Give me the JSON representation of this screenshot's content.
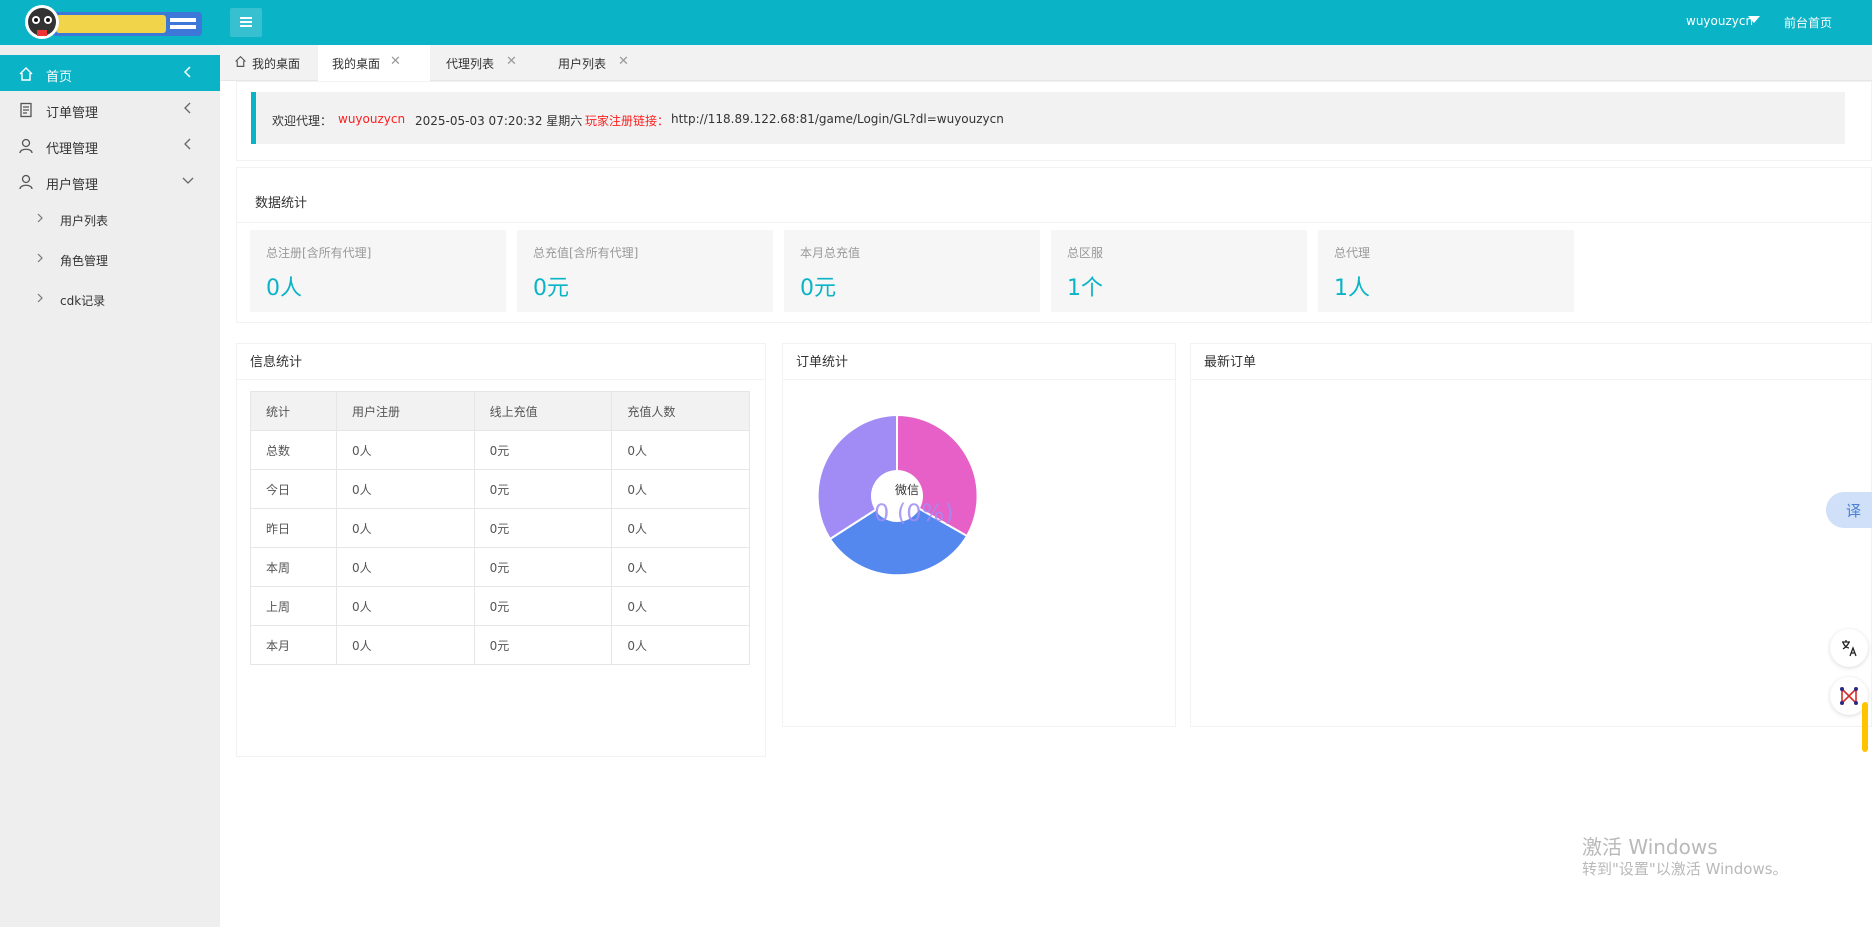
{
  "header": {
    "logo_alt": "游戏后台",
    "username": "wuyouzycn",
    "front_link": "前台首页"
  },
  "sidebar": {
    "items": [
      {
        "label": "首页"
      },
      {
        "label": "订单管理"
      },
      {
        "label": "代理管理"
      },
      {
        "label": "用户管理"
      }
    ],
    "sub_items": [
      {
        "label": "用户列表"
      },
      {
        "label": "角色管理"
      },
      {
        "label": "cdk记录"
      }
    ]
  },
  "tabs": [
    {
      "label": "我的桌面"
    },
    {
      "label": "我的桌面"
    },
    {
      "label": "代理列表"
    },
    {
      "label": "用户列表"
    }
  ],
  "welcome": {
    "prefix": "欢迎代理：",
    "agent": "wuyouzycn",
    "datetime": "2025-05-03  07:20:32  星期六",
    "link_label": "玩家注册链接：",
    "link": "http://118.89.122.68:81/game/Login/GL?dl=wuyouzycn"
  },
  "data_stats": {
    "title": "数据统计",
    "cards": [
      {
        "title": "总注册[含所有代理]",
        "value": "0人"
      },
      {
        "title": "总充值[含所有代理]",
        "value": "0元"
      },
      {
        "title": "本月总充值",
        "value": "0元"
      },
      {
        "title": "总区服",
        "value": "1个"
      },
      {
        "title": "总代理",
        "value": "1人"
      }
    ]
  },
  "info_stats": {
    "title": "信息统计",
    "headers": [
      "统计",
      "用户注册",
      "线上充值",
      "充值人数"
    ],
    "rows": [
      [
        "总数",
        "0人",
        "0元",
        "0人"
      ],
      [
        "今日",
        "0人",
        "0元",
        "0人"
      ],
      [
        "昨日",
        "0人",
        "0元",
        "0人"
      ],
      [
        "本周",
        "0人",
        "0元",
        "0人"
      ],
      [
        "上周",
        "0人",
        "0元",
        "0人"
      ],
      [
        "本月",
        "0人",
        "0元",
        "0人"
      ]
    ]
  },
  "order_stats": {
    "title": "订单统计",
    "center_label": "微信",
    "center_value": "0 (0%)",
    "colors": [
      "#e660c8",
      "#5588ee",
      "#a08cf4"
    ]
  },
  "latest_orders": {
    "title": "最新订单"
  },
  "float": {
    "translate": "译"
  },
  "watermark": {
    "line1": "激活 Windows",
    "line2": "转到\"设置\"以激活 Windows。"
  }
}
